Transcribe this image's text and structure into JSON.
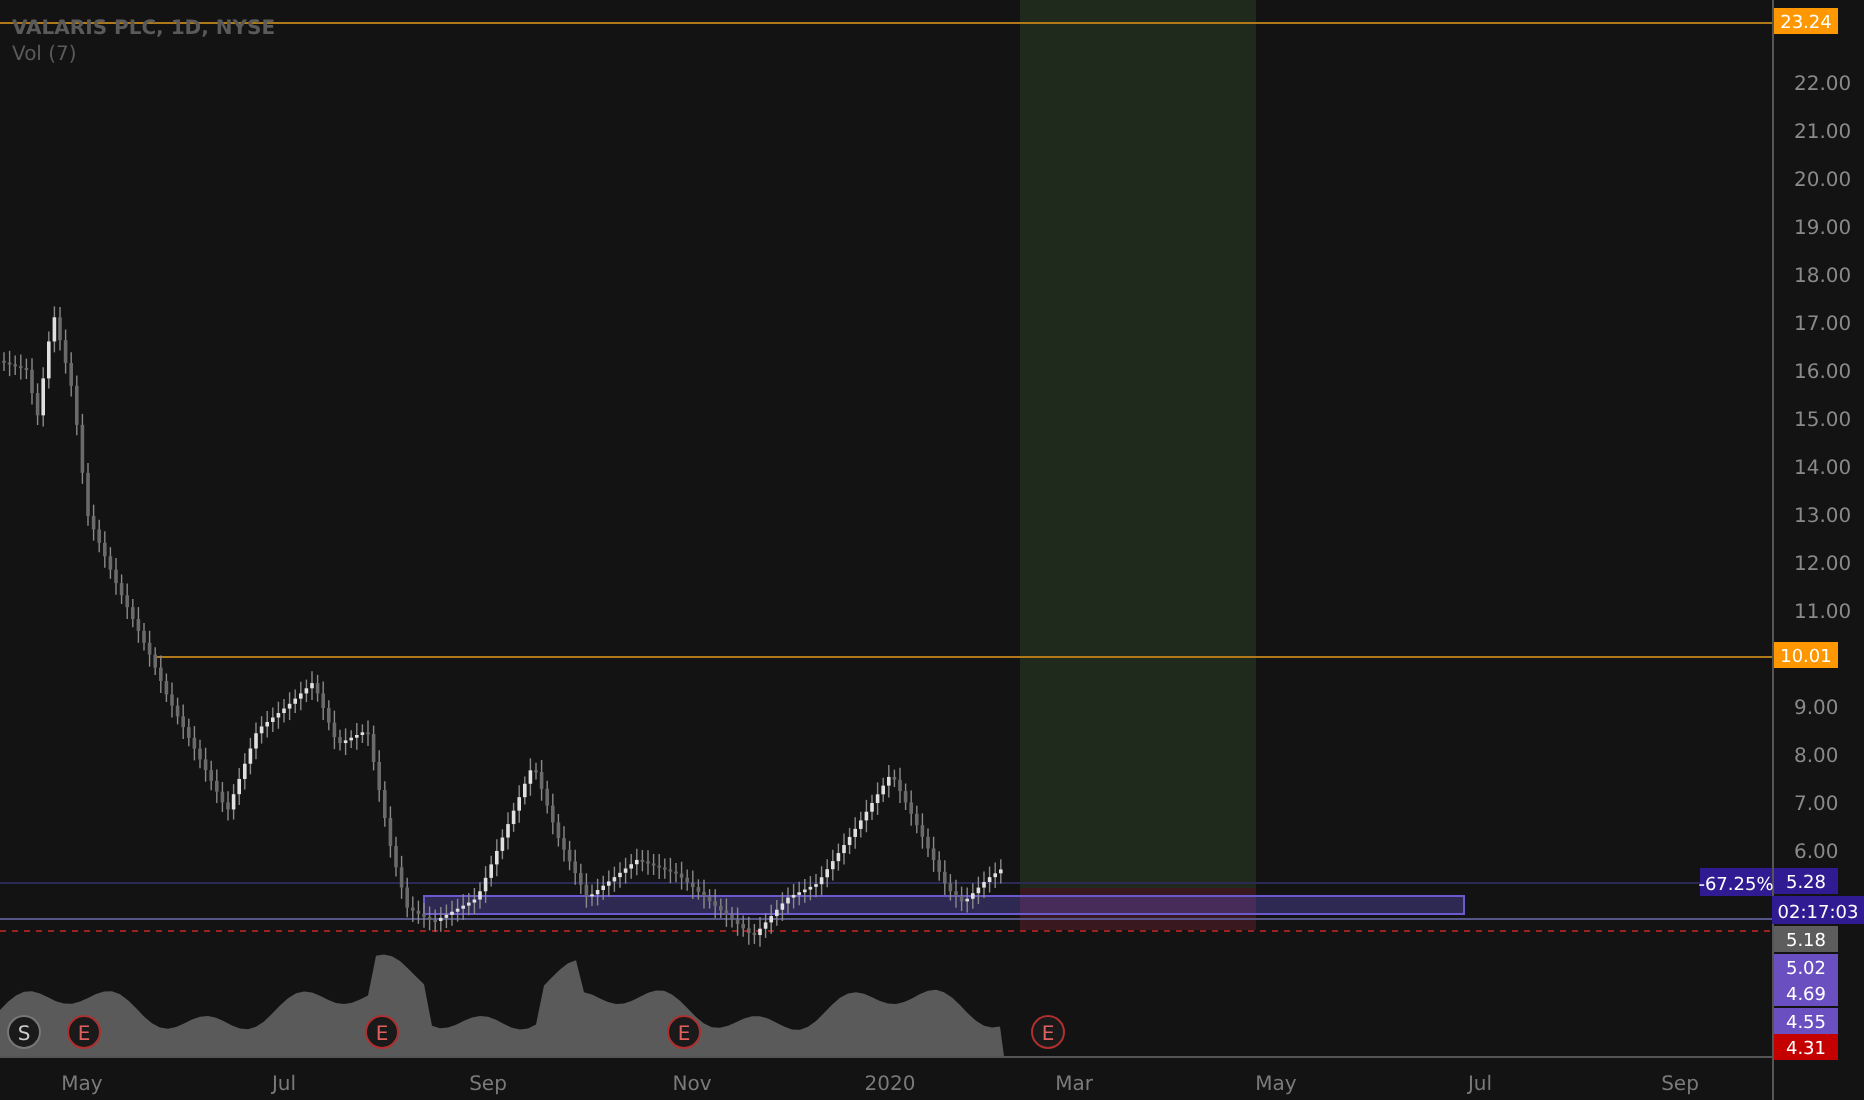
{
  "legend": {
    "title": "VALARIS PLC, 1D, NYSE",
    "indicator": "Vol (7)"
  },
  "price_axis": {
    "ticks": [
      "22.00",
      "21.00",
      "20.00",
      "19.00",
      "18.00",
      "17.00",
      "16.00",
      "15.00",
      "14.00",
      "13.00",
      "12.00",
      "11.00",
      "9.00",
      "8.00",
      "7.00",
      "6.00"
    ]
  },
  "time_axis": {
    "labels": [
      "May",
      "Jul",
      "Sep",
      "Nov",
      "2020",
      "Mar",
      "May",
      "Jul",
      "Sep"
    ]
  },
  "price_badges": [
    {
      "text": "23.24",
      "color": "#ff9800"
    },
    {
      "text": "10.01",
      "color": "#ff9800"
    },
    {
      "text": "5.28",
      "color": "#311b92"
    },
    {
      "text": "5.18",
      "color": "#5d5d5d"
    },
    {
      "text": "5.02",
      "color": "#6a4fc0"
    },
    {
      "text": "4.69",
      "color": "#6a4fc0"
    },
    {
      "text": "4.55",
      "color": "#6a4fc0"
    },
    {
      "text": "4.31",
      "color": "#c40000"
    }
  ],
  "change_label": "-67.25%",
  "countdown": "02:17:03",
  "events": [
    {
      "kind": "split",
      "letter": "S"
    },
    {
      "kind": "earnings",
      "letter": "E"
    },
    {
      "kind": "earnings",
      "letter": "E"
    },
    {
      "kind": "earnings",
      "letter": "E"
    },
    {
      "kind": "earnings",
      "letter": "E"
    }
  ]
}
